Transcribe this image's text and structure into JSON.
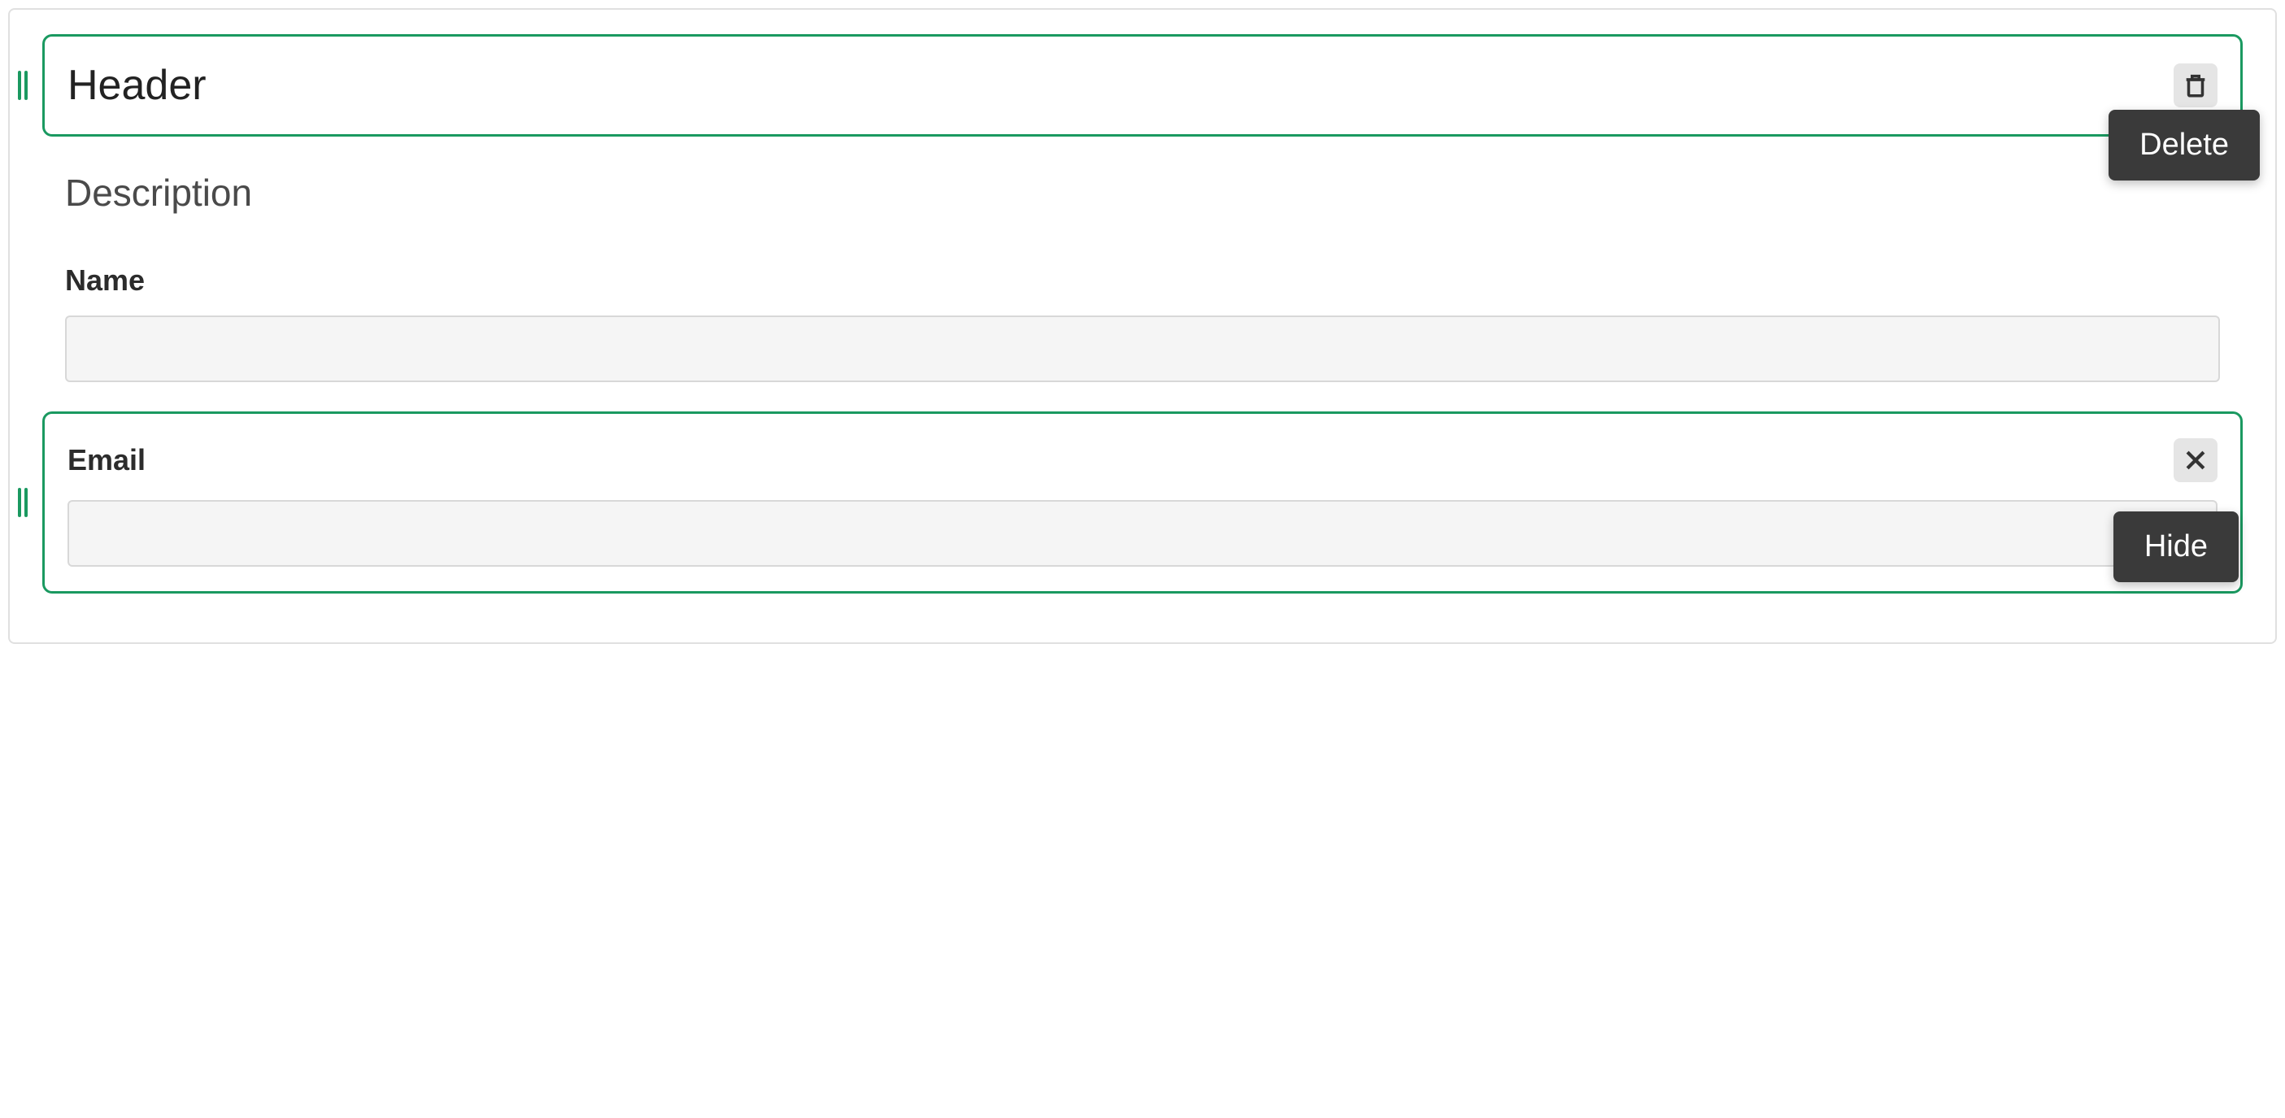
{
  "header": {
    "title": "Header",
    "delete_tooltip": "Delete"
  },
  "description": {
    "text": "Description"
  },
  "fields": {
    "name": {
      "label": "Name",
      "value": ""
    },
    "email": {
      "label": "Email",
      "value": "",
      "hide_tooltip": "Hide"
    }
  }
}
